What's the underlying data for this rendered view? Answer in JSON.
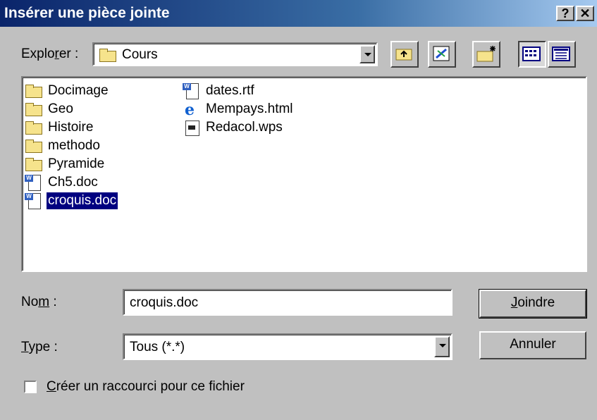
{
  "window": {
    "title": "Insérer une pièce jointe",
    "help_label": "?",
    "close_label": "✕"
  },
  "explorer": {
    "label_prefix": "Explo",
    "label_accel": "r",
    "label_suffix": "er :",
    "current_folder": "Cours"
  },
  "toolbar": {
    "up_icon": "up-folder-icon",
    "desktop_icon": "desktop-icon",
    "new_folder_icon": "new-folder-icon",
    "list_view_icon": "list-view-icon",
    "details_view_icon": "details-view-icon"
  },
  "files": {
    "column1": [
      {
        "name": "Docimage",
        "type": "folder"
      },
      {
        "name": "Geo",
        "type": "folder"
      },
      {
        "name": "Histoire",
        "type": "folder"
      },
      {
        "name": "methodo",
        "type": "folder"
      },
      {
        "name": "Pyramide",
        "type": "folder"
      },
      {
        "name": "Ch5.doc",
        "type": "doc"
      },
      {
        "name": "croquis.doc",
        "type": "doc",
        "selected": true
      }
    ],
    "column2": [
      {
        "name": "dates.rtf",
        "type": "doc"
      },
      {
        "name": "Mempays.html",
        "type": "html"
      },
      {
        "name": "Redacol.wps",
        "type": "wps"
      }
    ]
  },
  "form": {
    "name_label_prefix": "No",
    "name_label_accel": "m",
    "name_label_suffix": " :",
    "name_value": "croquis.doc",
    "type_label_accel": "T",
    "type_label_suffix": "ype :",
    "type_value": "Tous (*.*)",
    "shortcut_accel": "C",
    "shortcut_label_suffix": "réer un raccourci pour ce fichier",
    "shortcut_checked": false
  },
  "buttons": {
    "join_accel": "J",
    "join_suffix": "oindre",
    "cancel": "Annuler"
  }
}
